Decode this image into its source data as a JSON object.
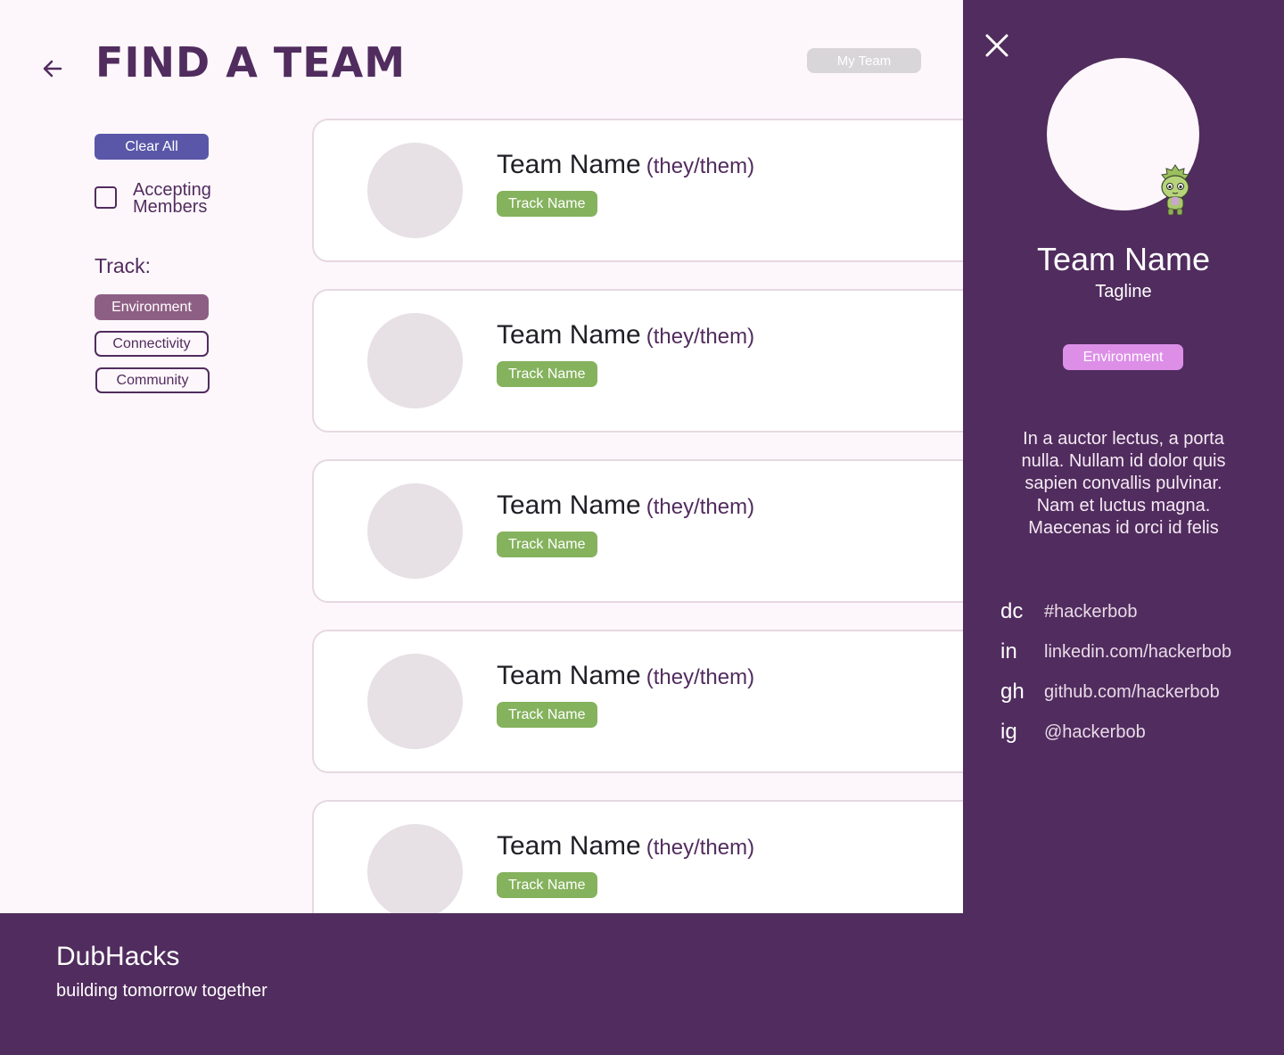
{
  "header": {
    "title": "FIND A TEAM",
    "my_team_label": "My Team",
    "back_icon": "arrow-left-icon"
  },
  "filters": {
    "clear_all_label": "Clear All",
    "accepting_label": "Accepting Members",
    "accepting_checked": false,
    "track_heading": "Track:",
    "tracks": [
      {
        "label": "Environment",
        "selected": true
      },
      {
        "label": "Connectivity",
        "selected": false
      },
      {
        "label": "Community",
        "selected": false
      }
    ]
  },
  "teams": [
    {
      "name": "Team Name",
      "pronouns": "(they/them)",
      "track": "Track Name"
    },
    {
      "name": "Team Name",
      "pronouns": "(they/them)",
      "track": "Track Name"
    },
    {
      "name": "Team Name",
      "pronouns": "(they/them)",
      "track": "Track Name"
    },
    {
      "name": "Team Name",
      "pronouns": "(they/them)",
      "track": "Track Name"
    },
    {
      "name": "Team Name",
      "pronouns": "(they/them)",
      "track": "Track Name"
    }
  ],
  "detail_panel": {
    "close_icon": "close-icon",
    "team_name": "Team Name",
    "tagline": "Tagline",
    "track": "Environment",
    "description": "In a auctor lectus, a porta nulla. Nullam id dolor quis sapien convallis pulvinar. Nam et luctus magna. Maecenas id orci id felis",
    "socials": [
      {
        "key": "dc",
        "value": "#hackerbob"
      },
      {
        "key": "in",
        "value": "linkedin.com/hackerbob"
      },
      {
        "key": "gh",
        "value": "github.com/hackerbob"
      },
      {
        "key": "ig",
        "value": "@hackerbob"
      }
    ]
  },
  "footer": {
    "brand": "DubHacks",
    "slogan": "building tomorrow together"
  },
  "colors": {
    "primary": "#512c5e",
    "background": "#fdf7fb",
    "clear_all": "#5a57a8",
    "track_green": "#85b25d",
    "environment_chip": "#8e5f84",
    "panel_track": "#dd8fe8"
  }
}
